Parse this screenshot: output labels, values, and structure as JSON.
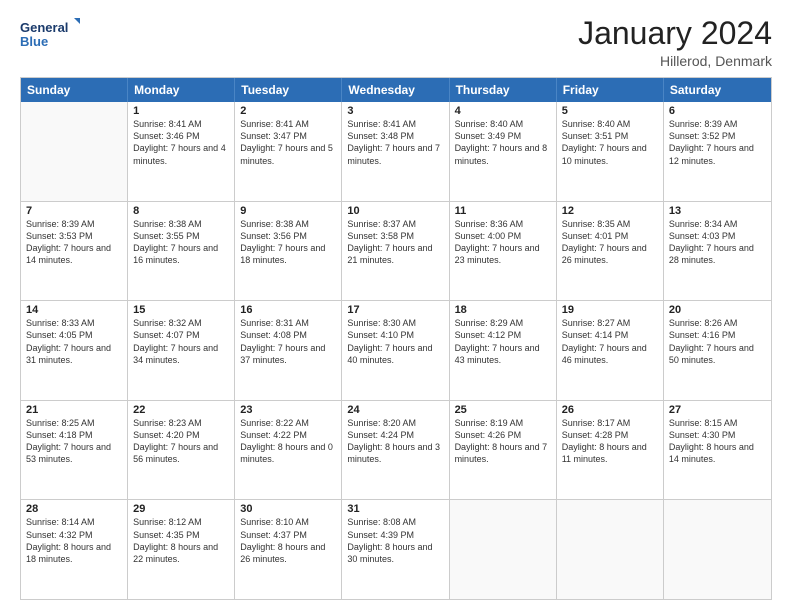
{
  "logo": {
    "line1": "General",
    "line2": "Blue"
  },
  "title": "January 2024",
  "subtitle": "Hillerod, Denmark",
  "header_days": [
    "Sunday",
    "Monday",
    "Tuesday",
    "Wednesday",
    "Thursday",
    "Friday",
    "Saturday"
  ],
  "weeks": [
    [
      {
        "day": "",
        "empty": true,
        "sunrise": "",
        "sunset": "",
        "daylight": ""
      },
      {
        "day": "1",
        "sunrise": "Sunrise: 8:41 AM",
        "sunset": "Sunset: 3:46 PM",
        "daylight": "Daylight: 7 hours and 4 minutes."
      },
      {
        "day": "2",
        "sunrise": "Sunrise: 8:41 AM",
        "sunset": "Sunset: 3:47 PM",
        "daylight": "Daylight: 7 hours and 5 minutes."
      },
      {
        "day": "3",
        "sunrise": "Sunrise: 8:41 AM",
        "sunset": "Sunset: 3:48 PM",
        "daylight": "Daylight: 7 hours and 7 minutes."
      },
      {
        "day": "4",
        "sunrise": "Sunrise: 8:40 AM",
        "sunset": "Sunset: 3:49 PM",
        "daylight": "Daylight: 7 hours and 8 minutes."
      },
      {
        "day": "5",
        "sunrise": "Sunrise: 8:40 AM",
        "sunset": "Sunset: 3:51 PM",
        "daylight": "Daylight: 7 hours and 10 minutes."
      },
      {
        "day": "6",
        "sunrise": "Sunrise: 8:39 AM",
        "sunset": "Sunset: 3:52 PM",
        "daylight": "Daylight: 7 hours and 12 minutes."
      }
    ],
    [
      {
        "day": "7",
        "sunrise": "Sunrise: 8:39 AM",
        "sunset": "Sunset: 3:53 PM",
        "daylight": "Daylight: 7 hours and 14 minutes."
      },
      {
        "day": "8",
        "sunrise": "Sunrise: 8:38 AM",
        "sunset": "Sunset: 3:55 PM",
        "daylight": "Daylight: 7 hours and 16 minutes."
      },
      {
        "day": "9",
        "sunrise": "Sunrise: 8:38 AM",
        "sunset": "Sunset: 3:56 PM",
        "daylight": "Daylight: 7 hours and 18 minutes."
      },
      {
        "day": "10",
        "sunrise": "Sunrise: 8:37 AM",
        "sunset": "Sunset: 3:58 PM",
        "daylight": "Daylight: 7 hours and 21 minutes."
      },
      {
        "day": "11",
        "sunrise": "Sunrise: 8:36 AM",
        "sunset": "Sunset: 4:00 PM",
        "daylight": "Daylight: 7 hours and 23 minutes."
      },
      {
        "day": "12",
        "sunrise": "Sunrise: 8:35 AM",
        "sunset": "Sunset: 4:01 PM",
        "daylight": "Daylight: 7 hours and 26 minutes."
      },
      {
        "day": "13",
        "sunrise": "Sunrise: 8:34 AM",
        "sunset": "Sunset: 4:03 PM",
        "daylight": "Daylight: 7 hours and 28 minutes."
      }
    ],
    [
      {
        "day": "14",
        "sunrise": "Sunrise: 8:33 AM",
        "sunset": "Sunset: 4:05 PM",
        "daylight": "Daylight: 7 hours and 31 minutes."
      },
      {
        "day": "15",
        "sunrise": "Sunrise: 8:32 AM",
        "sunset": "Sunset: 4:07 PM",
        "daylight": "Daylight: 7 hours and 34 minutes."
      },
      {
        "day": "16",
        "sunrise": "Sunrise: 8:31 AM",
        "sunset": "Sunset: 4:08 PM",
        "daylight": "Daylight: 7 hours and 37 minutes."
      },
      {
        "day": "17",
        "sunrise": "Sunrise: 8:30 AM",
        "sunset": "Sunset: 4:10 PM",
        "daylight": "Daylight: 7 hours and 40 minutes."
      },
      {
        "day": "18",
        "sunrise": "Sunrise: 8:29 AM",
        "sunset": "Sunset: 4:12 PM",
        "daylight": "Daylight: 7 hours and 43 minutes."
      },
      {
        "day": "19",
        "sunrise": "Sunrise: 8:27 AM",
        "sunset": "Sunset: 4:14 PM",
        "daylight": "Daylight: 7 hours and 46 minutes."
      },
      {
        "day": "20",
        "sunrise": "Sunrise: 8:26 AM",
        "sunset": "Sunset: 4:16 PM",
        "daylight": "Daylight: 7 hours and 50 minutes."
      }
    ],
    [
      {
        "day": "21",
        "sunrise": "Sunrise: 8:25 AM",
        "sunset": "Sunset: 4:18 PM",
        "daylight": "Daylight: 7 hours and 53 minutes."
      },
      {
        "day": "22",
        "sunrise": "Sunrise: 8:23 AM",
        "sunset": "Sunset: 4:20 PM",
        "daylight": "Daylight: 7 hours and 56 minutes."
      },
      {
        "day": "23",
        "sunrise": "Sunrise: 8:22 AM",
        "sunset": "Sunset: 4:22 PM",
        "daylight": "Daylight: 8 hours and 0 minutes."
      },
      {
        "day": "24",
        "sunrise": "Sunrise: 8:20 AM",
        "sunset": "Sunset: 4:24 PM",
        "daylight": "Daylight: 8 hours and 3 minutes."
      },
      {
        "day": "25",
        "sunrise": "Sunrise: 8:19 AM",
        "sunset": "Sunset: 4:26 PM",
        "daylight": "Daylight: 8 hours and 7 minutes."
      },
      {
        "day": "26",
        "sunrise": "Sunrise: 8:17 AM",
        "sunset": "Sunset: 4:28 PM",
        "daylight": "Daylight: 8 hours and 11 minutes."
      },
      {
        "day": "27",
        "sunrise": "Sunrise: 8:15 AM",
        "sunset": "Sunset: 4:30 PM",
        "daylight": "Daylight: 8 hours and 14 minutes."
      }
    ],
    [
      {
        "day": "28",
        "sunrise": "Sunrise: 8:14 AM",
        "sunset": "Sunset: 4:32 PM",
        "daylight": "Daylight: 8 hours and 18 minutes."
      },
      {
        "day": "29",
        "sunrise": "Sunrise: 8:12 AM",
        "sunset": "Sunset: 4:35 PM",
        "daylight": "Daylight: 8 hours and 22 minutes."
      },
      {
        "day": "30",
        "sunrise": "Sunrise: 8:10 AM",
        "sunset": "Sunset: 4:37 PM",
        "daylight": "Daylight: 8 hours and 26 minutes."
      },
      {
        "day": "31",
        "sunrise": "Sunrise: 8:08 AM",
        "sunset": "Sunset: 4:39 PM",
        "daylight": "Daylight: 8 hours and 30 minutes."
      },
      {
        "day": "",
        "empty": true,
        "sunrise": "",
        "sunset": "",
        "daylight": ""
      },
      {
        "day": "",
        "empty": true,
        "sunrise": "",
        "sunset": "",
        "daylight": ""
      },
      {
        "day": "",
        "empty": true,
        "sunrise": "",
        "sunset": "",
        "daylight": ""
      }
    ]
  ]
}
